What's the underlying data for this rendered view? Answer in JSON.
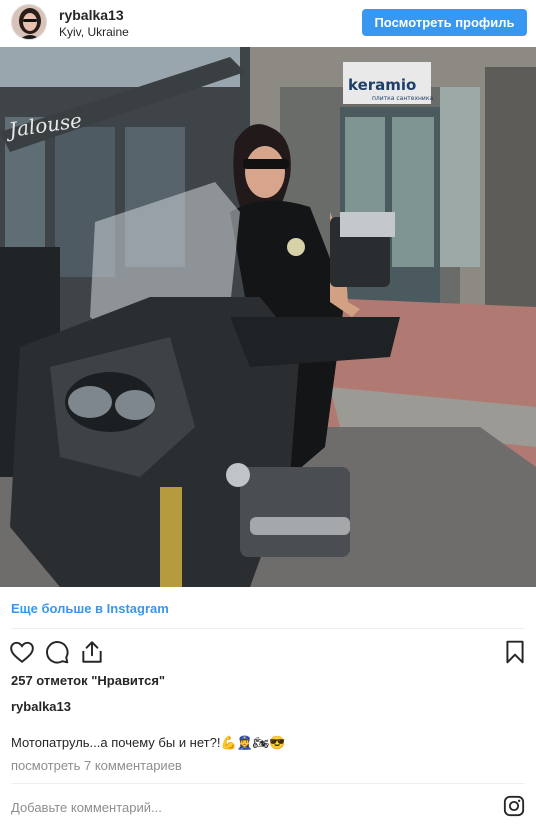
{
  "header": {
    "username": "rybalka13",
    "location": "Kyiv, Ukraine",
    "view_profile_label": "Посмотреть профиль"
  },
  "photo": {
    "store_sign_brand": "keramio",
    "store_sign_sub": "плитка сантехника",
    "shop_sign": "Jalouse"
  },
  "more_link": "Еще больше в Instagram",
  "actions": {
    "icons": [
      "heart-icon",
      "comment-icon",
      "share-icon",
      "bookmark-icon"
    ]
  },
  "likes_text": "257 отметок \"Нравится\"",
  "author": "rybalka13",
  "caption": "Мотопатруль...а почему бы и нет?!💪👮‍♀️🏍😎",
  "comments_link": "посмотреть 7 комментариев",
  "comment_placeholder": "Добавьте комментарий...",
  "colors": {
    "accent": "#3897f0",
    "text": "#262626",
    "muted": "#8e8e8e",
    "divider": "#efefef"
  }
}
